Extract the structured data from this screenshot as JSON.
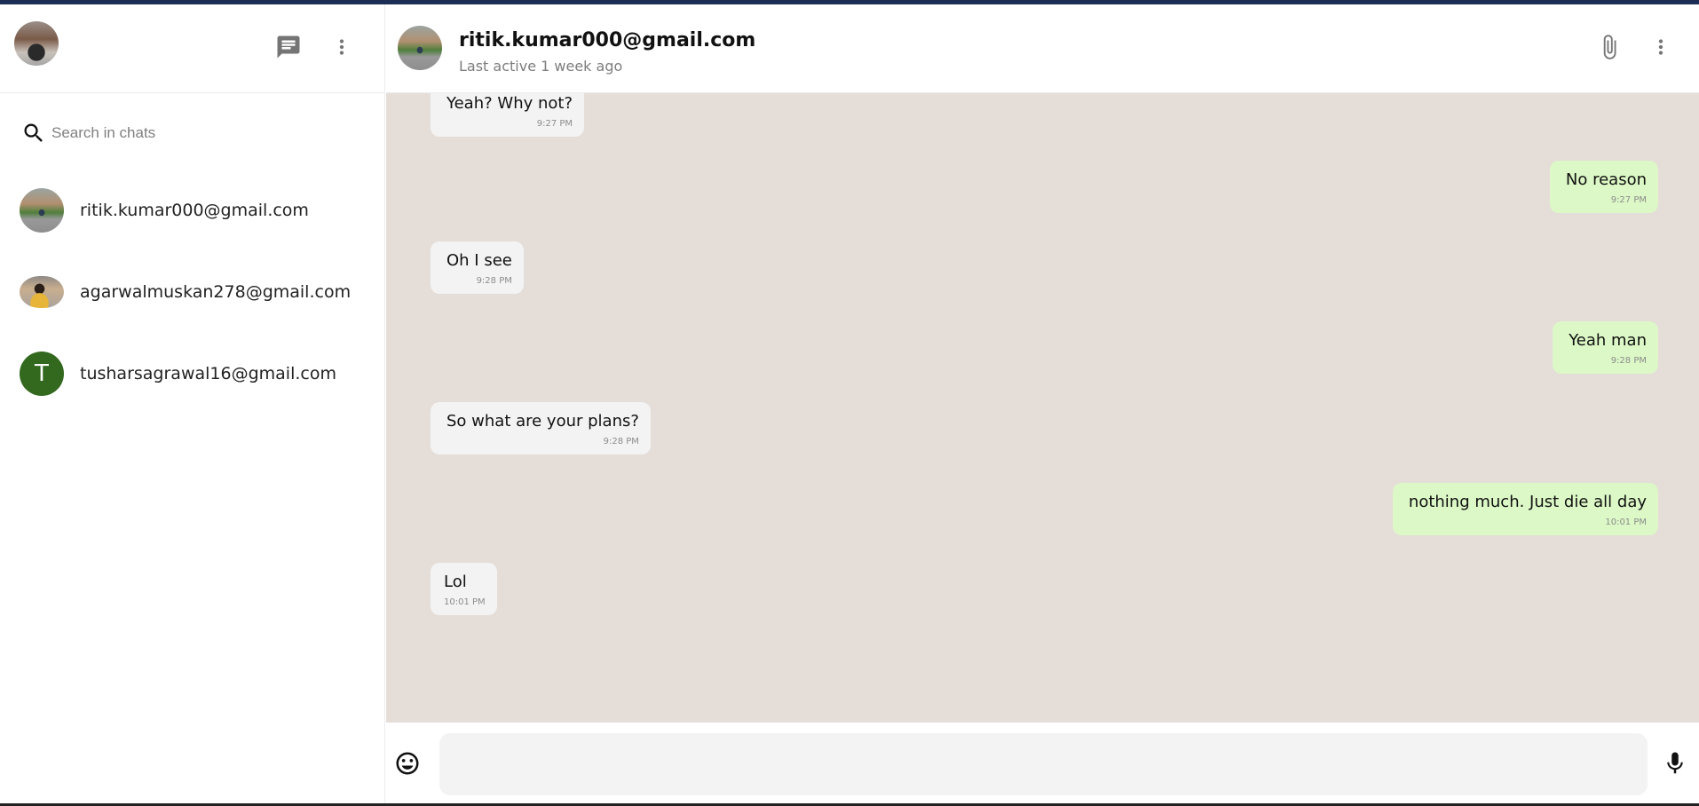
{
  "sidebar": {
    "new_chat_icon": "chat-icon",
    "menu_icon": "more-vert-icon",
    "search": {
      "placeholder": "Search in chats",
      "value": ""
    },
    "chats": [
      {
        "name": "ritik.kumar000@gmail.com",
        "avatar": "photo"
      },
      {
        "name": "agarwalmuskan278@gmail.com",
        "avatar": "photo"
      },
      {
        "name": "tusharsagrawal16@gmail.com",
        "avatar": "initial",
        "initial": "T",
        "color": "#33691e"
      }
    ]
  },
  "conversation": {
    "contact_name": "ritik.kumar000@gmail.com",
    "status": "Last active 1 week ago",
    "attach_icon": "paperclip-icon",
    "menu_icon": "more-vert-icon",
    "messages": [
      {
        "direction": "in",
        "text": "Yeah? Why not?",
        "time": "9:27 PM"
      },
      {
        "direction": "out",
        "text": "No reason",
        "time": "9:27 PM"
      },
      {
        "direction": "in",
        "text": "Oh I see",
        "time": "9:28 PM"
      },
      {
        "direction": "out",
        "text": "Yeah man",
        "time": "9:28 PM"
      },
      {
        "direction": "in",
        "text": "So what are your plans?",
        "time": "9:28 PM"
      },
      {
        "direction": "out",
        "text": "nothing much. Just die all day",
        "time": "10:01 PM"
      },
      {
        "direction": "in",
        "text": "Lol",
        "time": "10:01 PM"
      }
    ]
  },
  "composer": {
    "value": "",
    "emoji_icon": "emoji-icon",
    "mic_icon": "mic-icon"
  },
  "colors": {
    "topbar": "#1b2e55",
    "chat_background": "#e5ddd8",
    "incoming_bubble": "#f3f3f3",
    "outgoing_bubble": "#dcf8c6",
    "icon_gray": "#757575"
  }
}
